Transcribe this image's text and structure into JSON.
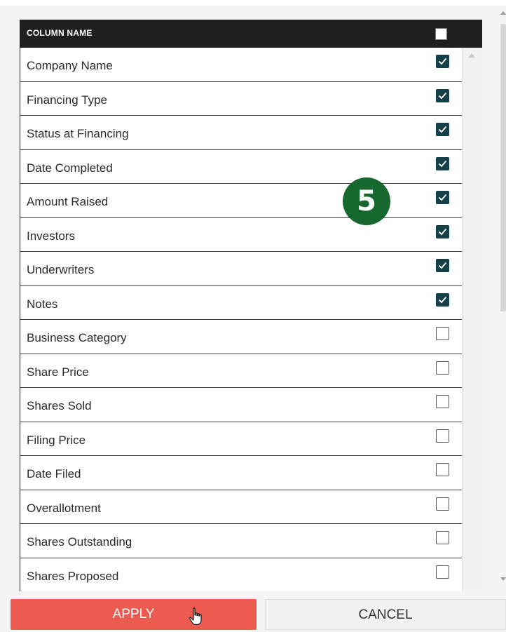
{
  "header": {
    "column_name_label": "COLUMN NAME",
    "select_all_checked": false
  },
  "rows": [
    {
      "label": "Company Name",
      "checked": true
    },
    {
      "label": "Financing Type",
      "checked": true
    },
    {
      "label": "Status at Financing",
      "checked": true
    },
    {
      "label": "Date Completed",
      "checked": true
    },
    {
      "label": "Amount Raised",
      "checked": true
    },
    {
      "label": "Investors",
      "checked": true
    },
    {
      "label": "Underwriters",
      "checked": true
    },
    {
      "label": "Notes",
      "checked": true
    },
    {
      "label": "Business Category",
      "checked": false
    },
    {
      "label": "Share Price",
      "checked": false
    },
    {
      "label": "Shares Sold",
      "checked": false
    },
    {
      "label": "Filing Price",
      "checked": false
    },
    {
      "label": "Date Filed",
      "checked": false
    },
    {
      "label": "Overallotment",
      "checked": false
    },
    {
      "label": "Shares Outstanding",
      "checked": false
    },
    {
      "label": "Shares Proposed",
      "checked": false
    }
  ],
  "step_badge": "5",
  "buttons": {
    "apply_label": "APPLY",
    "cancel_label": "CANCEL"
  },
  "colors": {
    "checkbox_checked": "#14404a",
    "apply_button": "#ec5a50",
    "step_badge": "#16682f",
    "header_bg": "#1f1f1f"
  }
}
